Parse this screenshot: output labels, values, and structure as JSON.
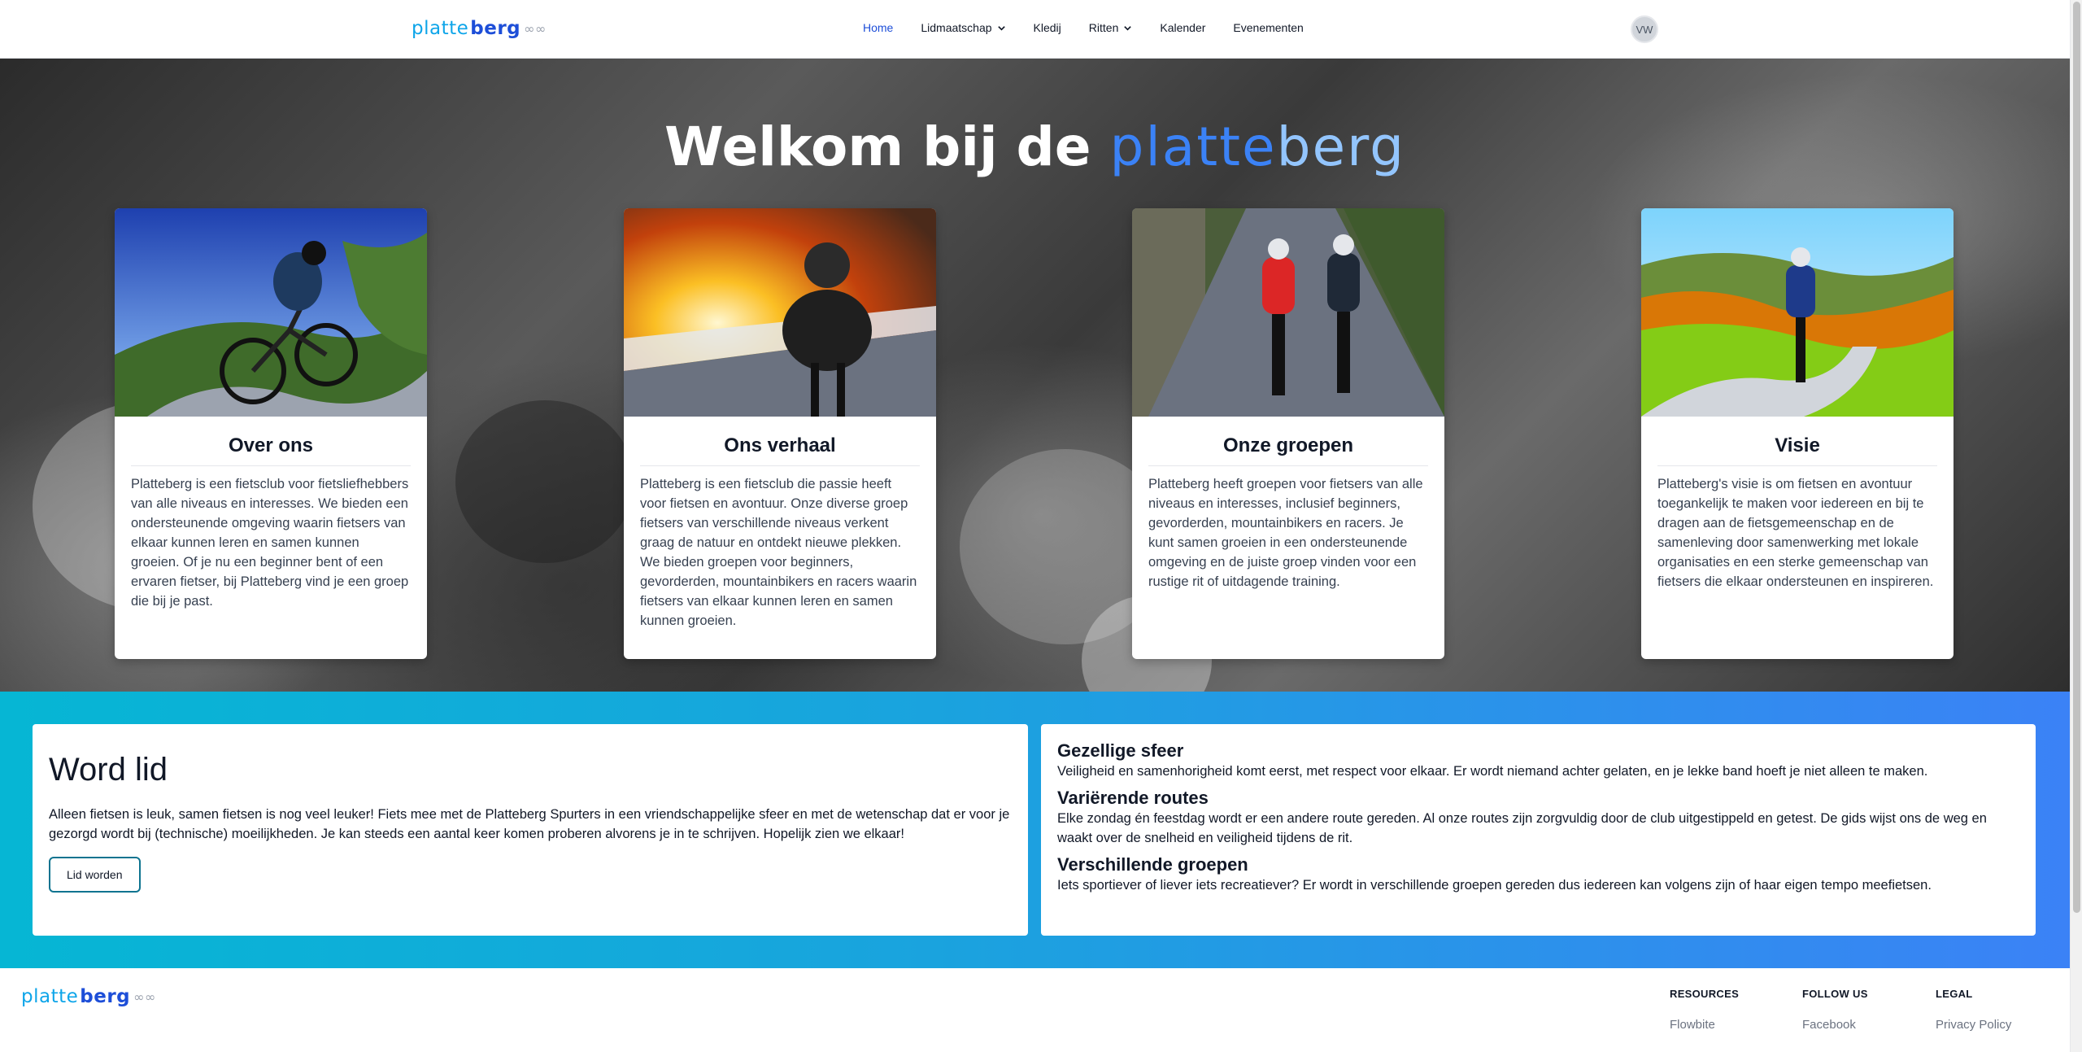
{
  "navbar": {
    "logo": {
      "part1": "platte",
      "part2": "berg",
      "part3": "∞∞"
    },
    "links": [
      {
        "label": "Home",
        "active": true,
        "dropdown": false
      },
      {
        "label": "Lidmaatschap",
        "active": false,
        "dropdown": true
      },
      {
        "label": "Kledij",
        "active": false,
        "dropdown": false
      },
      {
        "label": "Ritten",
        "active": false,
        "dropdown": true
      },
      {
        "label": "Kalender",
        "active": false,
        "dropdown": false
      },
      {
        "label": "Evenementen",
        "active": false,
        "dropdown": false
      }
    ],
    "avatar_initials": "VW"
  },
  "hero": {
    "title_prefix": "Welkom bij de",
    "title_brand_a": "platte",
    "title_brand_b": "berg",
    "cards": [
      {
        "title": "Over ons",
        "text": "Platteberg is een fietsclub voor fietsliefhebbers van alle niveaus en interesses. We bieden een ondersteunende omgeving waarin fietsers van elkaar kunnen leren en samen kunnen groeien. Of je nu een beginner bent of een ervaren fietser, bij Platteberg vind je een groep die bij je past."
      },
      {
        "title": "Ons verhaal",
        "text": "Platteberg is een fietsclub die passie heeft voor fietsen en avontuur. Onze diverse groep fietsers van verschillende niveaus verkent graag de natuur en ontdekt nieuwe plekken. We bieden groepen voor beginners, gevorderden, mountainbikers en racers waarin fietsers van elkaar kunnen leren en samen kunnen groeien."
      },
      {
        "title": "Onze groepen",
        "text": "Platteberg heeft groepen voor fietsers van alle niveaus en interesses, inclusief beginners, gevorderden, mountainbikers en racers. Je kunt samen groeien in een ondersteunende omgeving en de juiste groep vinden voor een rustige rit of uitdagende training."
      },
      {
        "title": "Visie",
        "text": "Platteberg's visie is om fietsen en avontuur toegankelijk te maken voor iedereen en bij te dragen aan de fietsgemeenschap en de samenleving door samenwerking met lokale organisaties en een sterke gemeenschap van fietsers die elkaar ondersteunen en inspireren."
      }
    ]
  },
  "join": {
    "title": "Word lid",
    "text": "Alleen fietsen is leuk, samen fietsen is nog veel leuker! Fiets mee met de Platteberg Spurters in een vriendschappelijke sfeer en met de wetenschap dat er voor je gezorgd wordt bij (technische) moeilijkheden. Je kan steeds een aantal keer komen proberen alvorens je in te schrijven. Hopelijk zien we elkaar!",
    "button": "Lid worden",
    "features": [
      {
        "title": "Gezellige sfeer",
        "text": "Veiligheid en samenhorigheid komt eerst, met respect voor elkaar. Er wordt niemand achter gelaten, en je lekke band hoeft je niet alleen te maken."
      },
      {
        "title": "Variërende routes",
        "text": "Elke zondag én feestdag wordt er een andere route gereden. Al onze routes zijn zorgvuldig door de club uitgestippeld en getest. De gids wijst ons de weg en waakt over de snelheid en veiligheid tijdens de rit."
      },
      {
        "title": "Verschillende groepen",
        "text": "Iets sportiever of liever iets recreatiever? Er wordt in verschillende groepen gereden dus iedereen kan volgens zijn of haar eigen tempo meefietsen."
      }
    ]
  },
  "footer": {
    "columns": [
      {
        "heading": "RESOURCES",
        "link": "Flowbite"
      },
      {
        "heading": "FOLLOW US",
        "link": "Facebook"
      },
      {
        "heading": "LEGAL",
        "link": "Privacy Policy"
      }
    ]
  }
}
